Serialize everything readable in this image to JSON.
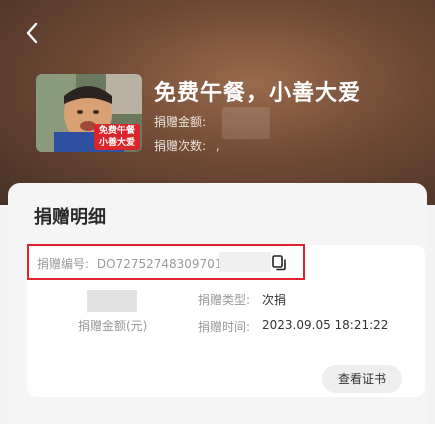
{
  "project": {
    "title": "免费午餐，小善大爱",
    "amount_label": "捐赠金额:",
    "count_label": "捐赠次数:",
    "count_value": ",",
    "thumb_badge_line1": "免费午餐",
    "thumb_badge_line2": "小善大爱"
  },
  "detail": {
    "section_title": "捐赠明细",
    "donation_no_label": "捐赠编号:",
    "donation_no_value": "DO72752748309701",
    "amount_label": "捐赠金额(元)",
    "type_label": "捐赠类型:",
    "type_value": "次捐",
    "time_label": "捐赠时间:",
    "time_value": "2023.09.05 18:21:22",
    "certificate_button": "查看证书"
  },
  "colors": {
    "highlight_border": "#e0262d",
    "hero_bg": "#6f4a35"
  },
  "icons": {
    "back": "chevron-left-icon",
    "copy": "copy-icon"
  }
}
